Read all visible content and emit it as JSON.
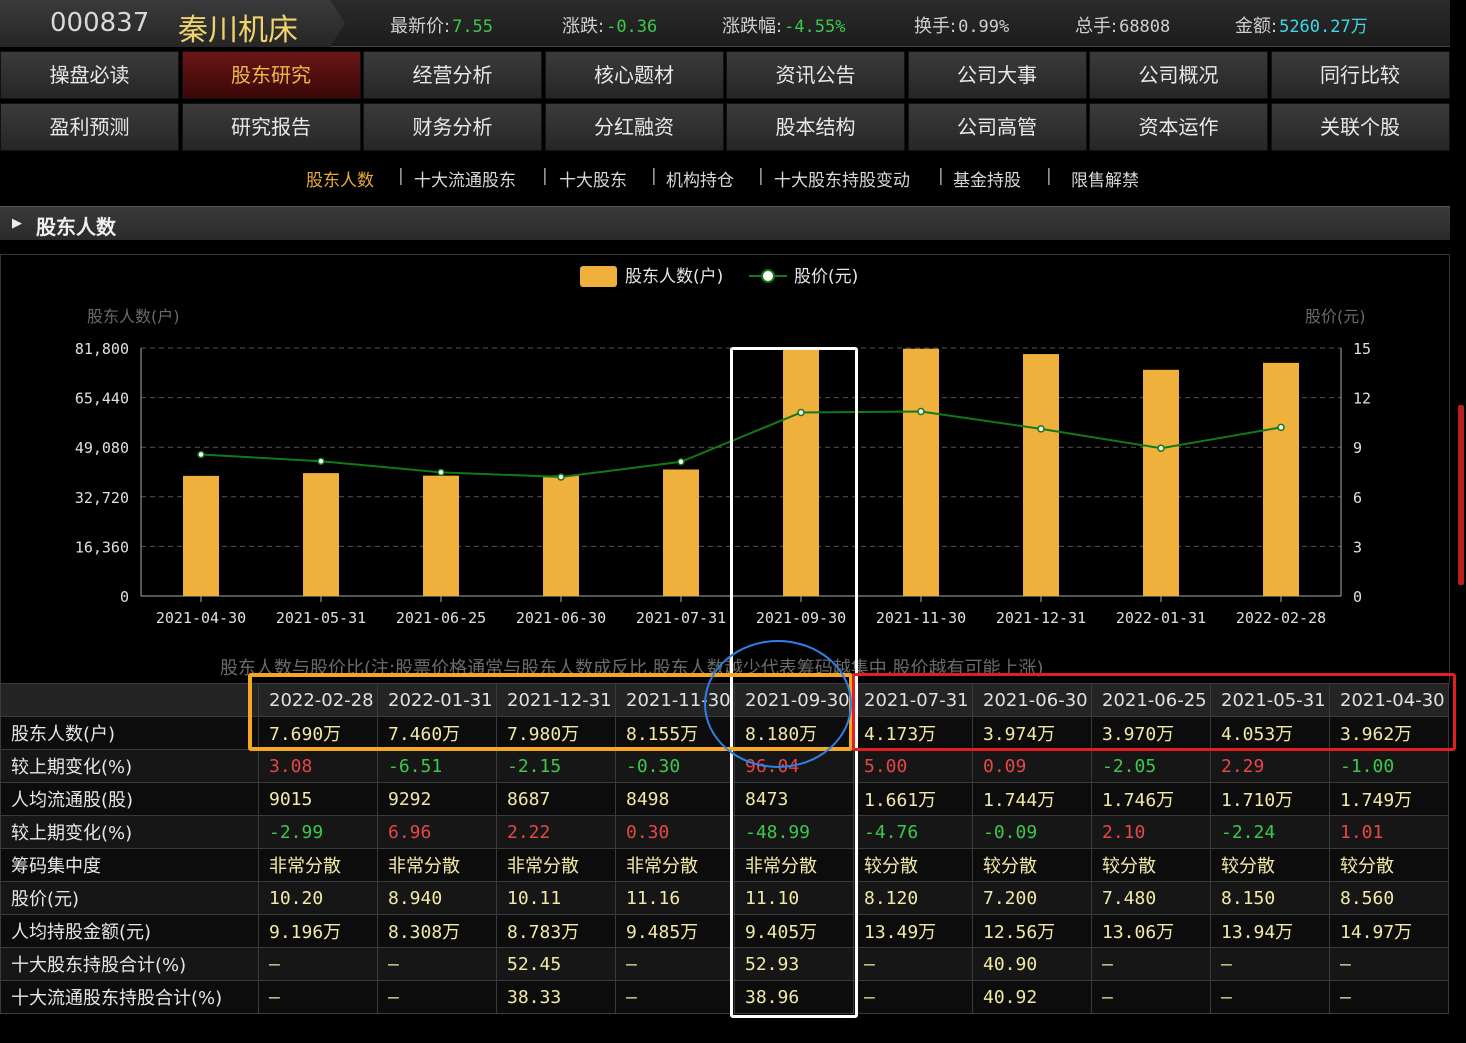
{
  "header": {
    "code": "000837",
    "name": "秦川机床",
    "quotes": [
      {
        "label": "最新价:",
        "value": "7.55",
        "color": "#3cc84c"
      },
      {
        "label": "涨跌:",
        "value": "-0.36",
        "color": "#3cc84c"
      },
      {
        "label": "涨跌幅:",
        "value": "-4.55%",
        "color": "#3cc84c"
      },
      {
        "label": "换手:",
        "value": "0.99%",
        "color": "#cfcfcf"
      },
      {
        "label": "总手:",
        "value": "68808",
        "color": "#cfcfcf"
      },
      {
        "label": "金额:",
        "value": "5260.27万",
        "color": "#3fd8e8"
      }
    ]
  },
  "tabs": [
    [
      "操盘必读",
      "股东研究",
      "经营分析",
      "核心题材",
      "资讯公告",
      "公司大事",
      "公司概况",
      "同行比较"
    ],
    [
      "盈利预测",
      "研究报告",
      "财务分析",
      "分红融资",
      "股本结构",
      "公司高管",
      "资本运作",
      "关联个股"
    ]
  ],
  "subnav": {
    "items": [
      "股东人数",
      "十大流通股东",
      "十大股东",
      "机构持仓",
      "十大股东持股变动",
      "基金持股",
      "限售解禁"
    ],
    "separator": "|"
  },
  "section_title": "股东人数",
  "chart_data": {
    "type": "bar",
    "legend": [
      "股东人数(户)",
      "股价(元)"
    ],
    "ylabel_left": "股东人数(户)",
    "ylabel_right": "股价(元)",
    "left_ticks": [
      "81,800",
      "65,440",
      "49,080",
      "32,720",
      "16,360",
      "0"
    ],
    "right_ticks": [
      "15",
      "12",
      "9",
      "6",
      "3",
      "0"
    ],
    "ylim_left": [
      0,
      81800
    ],
    "ylim_right": [
      0,
      15
    ],
    "categories": [
      "2021-04-30",
      "2021-05-31",
      "2021-06-25",
      "2021-06-30",
      "2021-07-31",
      "2021-09-30",
      "2021-11-30",
      "2021-12-31",
      "2022-01-31",
      "2022-02-28"
    ],
    "series": [
      {
        "name": "股东人数(户)",
        "type": "bar",
        "color": "#f0b03c",
        "values": [
          39620,
          40530,
          39700,
          39740,
          41730,
          81800,
          81550,
          79800,
          74600,
          76900
        ]
      },
      {
        "name": "股价(元)",
        "type": "line",
        "color": "#0f7a16",
        "values": [
          8.56,
          8.15,
          7.48,
          7.2,
          8.12,
          11.1,
          11.16,
          10.11,
          8.94,
          10.2
        ]
      }
    ],
    "grid": true
  },
  "note": "股东人数与股价比(注:股票价格通常与股东人数成反比,股东人数越少代表筹码越集中,股价越有可能上涨)",
  "table": {
    "dates": [
      "2022-02-28",
      "2022-01-31",
      "2021-12-31",
      "2021-11-30",
      "2021-09-30",
      "2021-07-31",
      "2021-06-30",
      "2021-06-25",
      "2021-05-31",
      "2021-04-30"
    ],
    "rows": [
      {
        "label": "股东人数(户)",
        "values": [
          "7.690万",
          "7.460万",
          "7.980万",
          "8.155万",
          "8.180万",
          "4.173万",
          "3.974万",
          "3.970万",
          "4.053万",
          "3.962万"
        ]
      },
      {
        "label": "较上期变化(%)",
        "colored": true,
        "values": [
          "3.08",
          "-6.51",
          "-2.15",
          "-0.30",
          "96.04",
          "5.00",
          "0.09",
          "-2.05",
          "2.29",
          "-1.00"
        ]
      },
      {
        "label": "人均流通股(股)",
        "values": [
          "9015",
          "9292",
          "8687",
          "8498",
          "8473",
          "1.661万",
          "1.744万",
          "1.746万",
          "1.710万",
          "1.749万"
        ]
      },
      {
        "label": "较上期变化(%)",
        "colored": true,
        "values": [
          "-2.99",
          "6.96",
          "2.22",
          "0.30",
          "-48.99",
          "-4.76",
          "-0.09",
          "2.10",
          "-2.24",
          "1.01"
        ]
      },
      {
        "label": "筹码集中度",
        "zh": true,
        "values": [
          "非常分散",
          "非常分散",
          "非常分散",
          "非常分散",
          "非常分散",
          "较分散",
          "较分散",
          "较分散",
          "较分散",
          "较分散"
        ]
      },
      {
        "label": "股价(元)",
        "values": [
          "10.20",
          "8.940",
          "10.11",
          "11.16",
          "11.10",
          "8.120",
          "7.200",
          "7.480",
          "8.150",
          "8.560"
        ]
      },
      {
        "label": "人均持股金额(元)",
        "values": [
          "9.196万",
          "8.308万",
          "8.783万",
          "9.485万",
          "9.405万",
          "13.49万",
          "12.56万",
          "13.06万",
          "13.94万",
          "14.97万"
        ]
      },
      {
        "label": "十大股东持股合计(%)",
        "values": [
          "—",
          "—",
          "52.45",
          "—",
          "52.93",
          "—",
          "40.90",
          "—",
          "—",
          "—"
        ]
      },
      {
        "label": "十大流通股东持股合计(%)",
        "values": [
          "—",
          "—",
          "38.33",
          "—",
          "38.96",
          "—",
          "40.92",
          "—",
          "—",
          "—"
        ]
      }
    ]
  }
}
